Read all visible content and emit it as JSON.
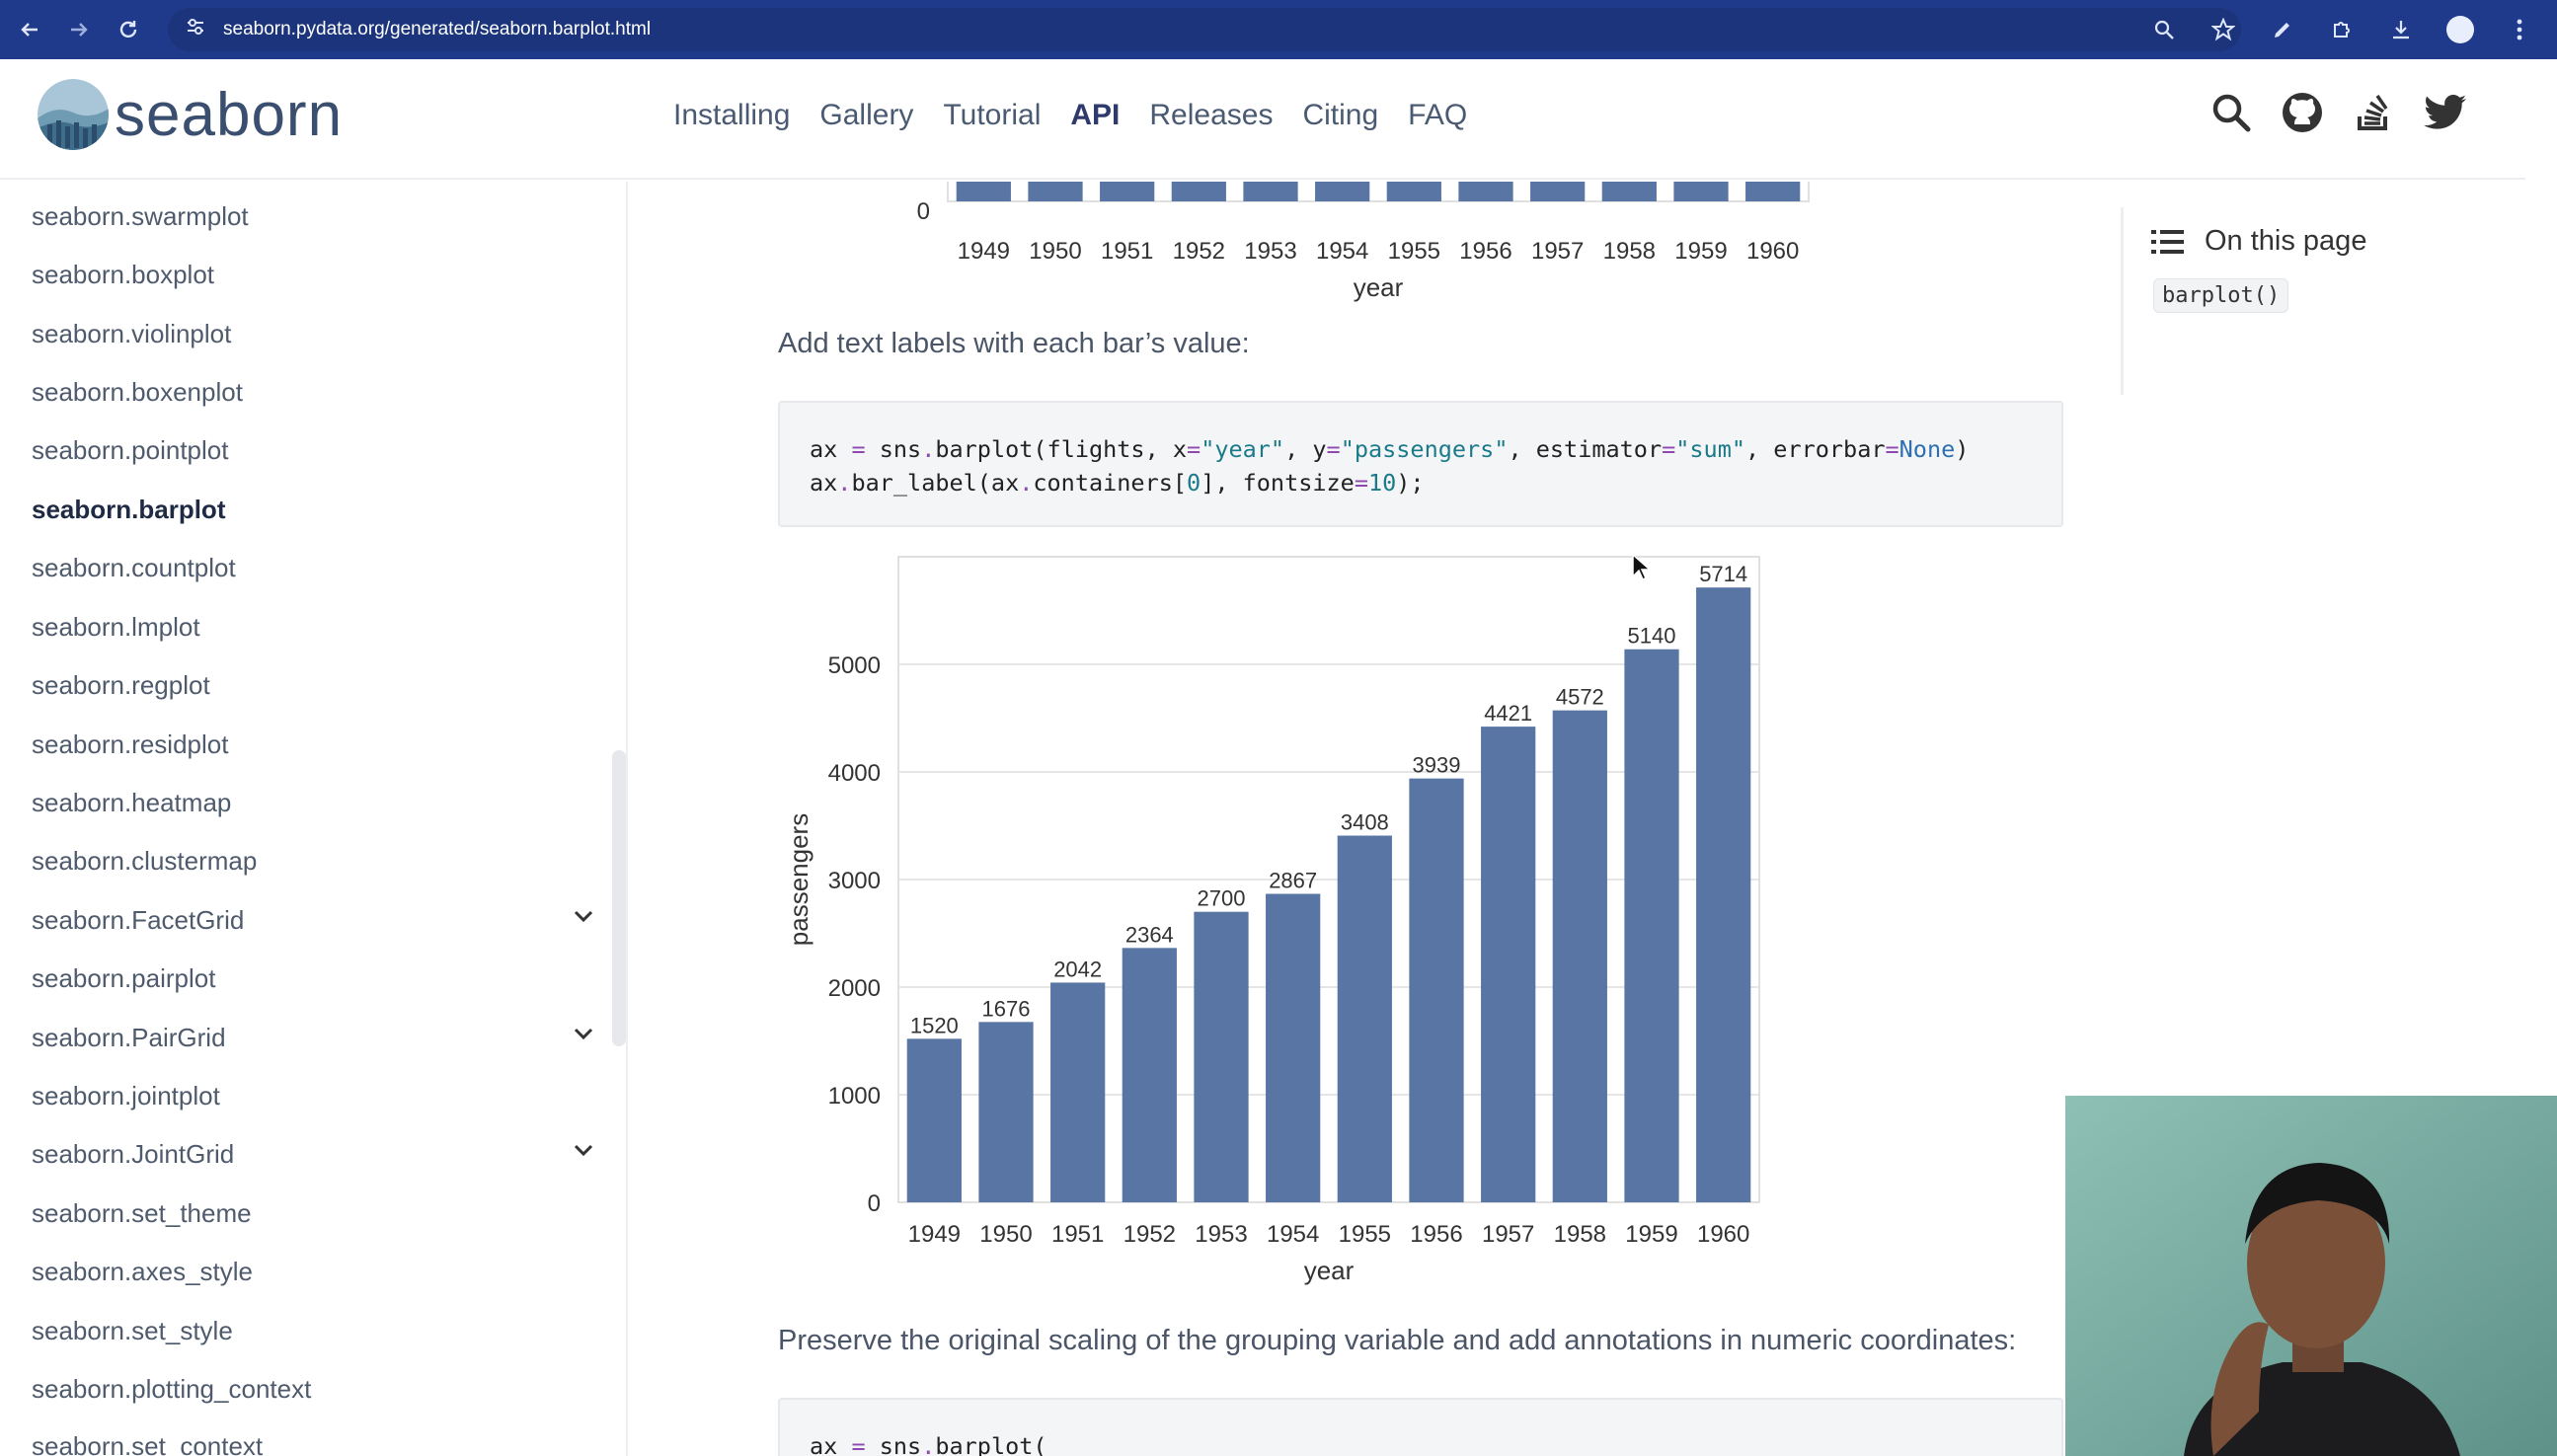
{
  "browser": {
    "url": "seaborn.pydata.org/generated/seaborn.barplot.html",
    "nav_icons": [
      "back-arrow-icon",
      "forward-arrow-icon",
      "reload-icon"
    ]
  },
  "site": {
    "logo_text": "seaborn",
    "nav": [
      {
        "label": "Installing"
      },
      {
        "label": "Gallery"
      },
      {
        "label": "Tutorial"
      },
      {
        "label": "API",
        "active": true
      },
      {
        "label": "Releases"
      },
      {
        "label": "Citing"
      },
      {
        "label": "FAQ"
      }
    ],
    "header_icons": [
      "search-icon",
      "github-icon",
      "stackoverflow-icon",
      "twitter-icon"
    ]
  },
  "sidebar": {
    "items": [
      {
        "label": "seaborn.swarmplot"
      },
      {
        "label": "seaborn.boxplot"
      },
      {
        "label": "seaborn.violinplot"
      },
      {
        "label": "seaborn.boxenplot"
      },
      {
        "label": "seaborn.pointplot"
      },
      {
        "label": "seaborn.barplot",
        "active": true
      },
      {
        "label": "seaborn.countplot"
      },
      {
        "label": "seaborn.lmplot"
      },
      {
        "label": "seaborn.regplot"
      },
      {
        "label": "seaborn.residplot"
      },
      {
        "label": "seaborn.heatmap"
      },
      {
        "label": "seaborn.clustermap"
      },
      {
        "label": "seaborn.FacetGrid",
        "expandable": true
      },
      {
        "label": "seaborn.pairplot"
      },
      {
        "label": "seaborn.PairGrid",
        "expandable": true
      },
      {
        "label": "seaborn.jointplot"
      },
      {
        "label": "seaborn.JointGrid",
        "expandable": true
      },
      {
        "label": "seaborn.set_theme"
      },
      {
        "label": "seaborn.axes_style"
      },
      {
        "label": "seaborn.set_style"
      },
      {
        "label": "seaborn.plotting_context"
      },
      {
        "label": "seaborn.set_context"
      }
    ]
  },
  "main": {
    "para1": "Add text labels with each bar’s value:",
    "code1_line1": {
      "a": "ax ",
      "op1": "=",
      "b": " sns",
      "op2": ".",
      "c": "barplot(flights, x",
      "op3": "=",
      "s1": "\"year\"",
      "d": ", y",
      "op4": "=",
      "s2": "\"passengers\"",
      "e": ", estimator",
      "op5": "=",
      "s3": "\"sum\"",
      "f": ", errorbar",
      "op6": "=",
      "kw": "None",
      "g": ")"
    },
    "code1_line2": {
      "a": "ax",
      "op1": ".",
      "b": "bar_label(ax",
      "op2": ".",
      "c": "containers[",
      "n1": "0",
      "d": "], fontsize",
      "op3": "=",
      "n2": "10",
      "e": ");"
    },
    "para2": "Preserve the original scaling of the grouping variable and add annotations in numeric coordinates:",
    "code2_line1": {
      "a": "ax ",
      "op1": "=",
      "b": " sns",
      "op2": ".",
      "c": "barplot("
    }
  },
  "toc": {
    "heading": "On this page",
    "link": "barplot()"
  },
  "top_chart_partial": {
    "ytick": "0",
    "categories": [
      "1949",
      "1950",
      "1951",
      "1952",
      "1953",
      "1954",
      "1955",
      "1956",
      "1957",
      "1958",
      "1959",
      "1960"
    ],
    "xlabel": "year"
  },
  "chart_data": {
    "type": "bar",
    "categories": [
      "1949",
      "1950",
      "1951",
      "1952",
      "1953",
      "1954",
      "1955",
      "1956",
      "1957",
      "1958",
      "1959",
      "1960"
    ],
    "values": [
      1520,
      1676,
      2042,
      2364,
      2700,
      2867,
      3408,
      3939,
      4421,
      4572,
      5140,
      5714
    ],
    "data_labels": [
      "1520",
      "1676",
      "2042",
      "2364",
      "2700",
      "2867",
      "3408",
      "3939",
      "4421",
      "4572",
      "5140",
      "5714"
    ],
    "xlabel": "year",
    "ylabel": "passengers",
    "yticks": [
      0,
      1000,
      2000,
      3000,
      4000,
      5000
    ],
    "ylim": [
      0,
      6000
    ],
    "bar_color": "#5975a4",
    "grid": true
  }
}
